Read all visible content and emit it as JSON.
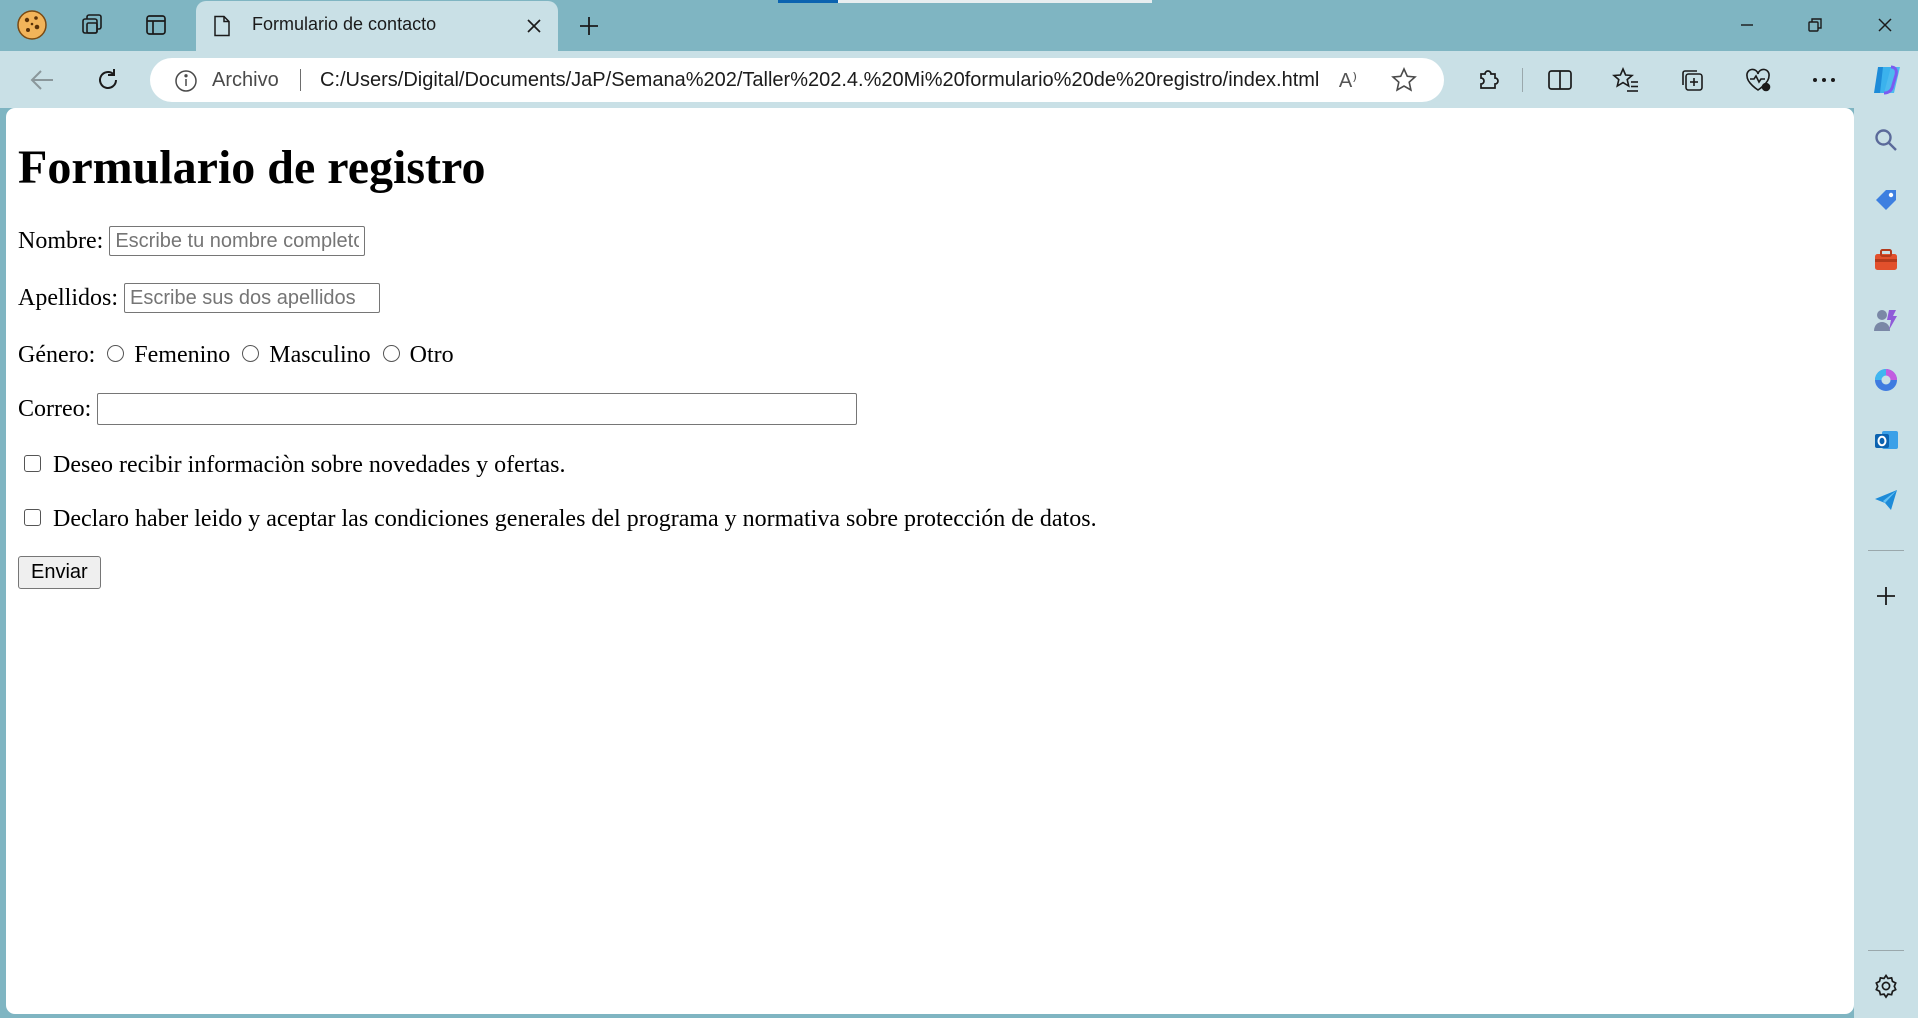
{
  "browser": {
    "window_controls": {
      "minimize_icon": "minimize-icon",
      "restore_icon": "restore-icon",
      "close_icon": "close-icon"
    },
    "tab": {
      "title": "Formulario de contacto"
    },
    "loading_progress": 0.16,
    "address_bar": {
      "site_label": "Archivo",
      "url": "C:/Users/Digital/Documents/JaP/Semana%202/Taller%202.4.%20Mi%20formulario%20de%20registro/index.html",
      "read_aloud": "A⁾"
    },
    "colors": {
      "frame": "#7fb5c2",
      "toolbar": "#c9e0e6",
      "accent": "#0b63b0"
    }
  },
  "form": {
    "title": "Formulario de registro",
    "nombre": {
      "label": "Nombre:",
      "placeholder": "Escribe tu nombre completo",
      "value": ""
    },
    "apellidos": {
      "label": "Apellidos:",
      "placeholder": "Escribe sus dos apellidos",
      "value": ""
    },
    "genero": {
      "label": "Género:",
      "options": [
        "Femenino",
        "Masculino",
        "Otro"
      ],
      "selected": null
    },
    "correo": {
      "label": "Correo:",
      "value": ""
    },
    "checkboxes": [
      {
        "label": "Deseo recibir informaciòn sobre novedades y ofertas.",
        "checked": false
      },
      {
        "label": "Declaro haber leido y aceptar las condiciones generales del programa y normativa sobre protección de datos.",
        "checked": false
      }
    ],
    "submit_label": "Enviar"
  }
}
